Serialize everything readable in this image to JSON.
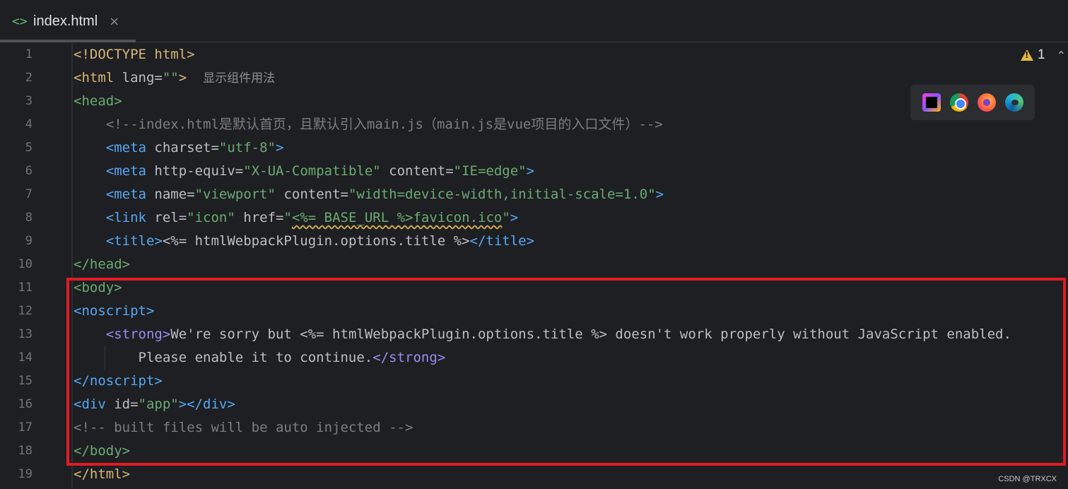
{
  "tab": {
    "icon": "<>",
    "label": "index.html",
    "close": "×"
  },
  "warnings": {
    "count": "1"
  },
  "browsers": [
    "intellij-icon",
    "chrome-icon",
    "firefox-icon",
    "edge-icon"
  ],
  "highlight_color": "#e01b24",
  "line_numbers": [
    "1",
    "2",
    "3",
    "4",
    "5",
    "6",
    "7",
    "8",
    "9",
    "10",
    "11",
    "12",
    "13",
    "14",
    "15",
    "16",
    "17",
    "18",
    "19"
  ],
  "code": {
    "l1": {
      "doctype": "<!DOCTYPE",
      "html": " html>"
    },
    "l2": {
      "open": "<html",
      "attr": " lang=",
      "val": "\"\"",
      "close": ">",
      "hint": "显示组件用法"
    },
    "l3": {
      "tag": "<head>"
    },
    "l4": {
      "comment": "<!--index.html是默认首页，且默认引入main.js（main.js是vue项目的入口文件）-->"
    },
    "l5": {
      "open": "<meta",
      "attr": " charset=",
      "val": "\"utf-8\"",
      "close": ">"
    },
    "l6": {
      "open": "<meta",
      "attr1": " http-equiv=",
      "val1": "\"X-UA-Compatible\"",
      "attr2": " content=",
      "val2": "\"IE=edge\"",
      "close": ">"
    },
    "l7": {
      "open": "<meta",
      "attr1": " name=",
      "val1": "\"viewport\"",
      "attr2": " content=",
      "val2": "\"width=device-width,initial-scale=1.0\"",
      "close": ">"
    },
    "l8": {
      "open": "<link",
      "attr1": " rel=",
      "val1": "\"icon\"",
      "attr2": " href=",
      "q1": "\"",
      "warn": "<%= BASE_URL %>favicon.ico",
      "q2": "\"",
      "close": ">"
    },
    "l9": {
      "open": "<title>",
      "text": "<%= htmlWebpackPlugin.options.title %>",
      "close": "</title>"
    },
    "l10": {
      "tag": "</head>"
    },
    "l11": {
      "tag": "<body>"
    },
    "l12": {
      "tag": "<noscript>"
    },
    "l13": {
      "open": "<strong>",
      "text": "We're sorry but <%= htmlWebpackPlugin.options.title %> doesn't work properly without JavaScript enabled."
    },
    "l14": {
      "text": "Please enable it to continue.",
      "close": "</strong>"
    },
    "l15": {
      "tag": "</noscript>"
    },
    "l16": {
      "open": "<div",
      "attr": " id=",
      "val": "\"app\"",
      "close": "></div>"
    },
    "l17": {
      "comment": "<!-- built files will be auto injected -->"
    },
    "l18": {
      "tag": "</body>"
    },
    "l19": {
      "tag": "</html>"
    }
  },
  "watermark": "CSDN @TRXCX"
}
